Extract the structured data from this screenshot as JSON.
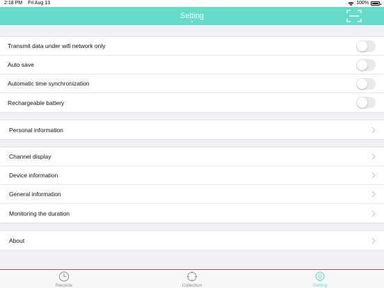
{
  "status_bar": {
    "time": "2:18 PM",
    "date": "Fri Aug 13",
    "battery": "100%"
  },
  "header": {
    "title": "Setting",
    "scan_icon": "scan-frame-icon"
  },
  "toggles": [
    {
      "label": "Transmit data under wifi network only",
      "on": false
    },
    {
      "label": "Auto save",
      "on": false
    },
    {
      "label": "Automatic time synchronization",
      "on": false
    },
    {
      "label": "Rechargeable battery",
      "on": false
    }
  ],
  "groups": [
    {
      "items": [
        "Personal information"
      ]
    },
    {
      "items": [
        "Channel display",
        "Device information",
        "General information",
        "Monitoring the duration"
      ]
    },
    {
      "items": [
        "About"
      ]
    }
  ],
  "tabs": [
    {
      "label": "Records",
      "icon": "clock-icon",
      "active": false
    },
    {
      "label": "Collection",
      "icon": "crosshair-icon",
      "active": false
    },
    {
      "label": "Setting",
      "icon": "gear-icon",
      "active": true
    }
  ],
  "colors": {
    "accent": "#65dbc9",
    "toggle_off": "#e9e9eb",
    "background": "#f0f0f4"
  }
}
